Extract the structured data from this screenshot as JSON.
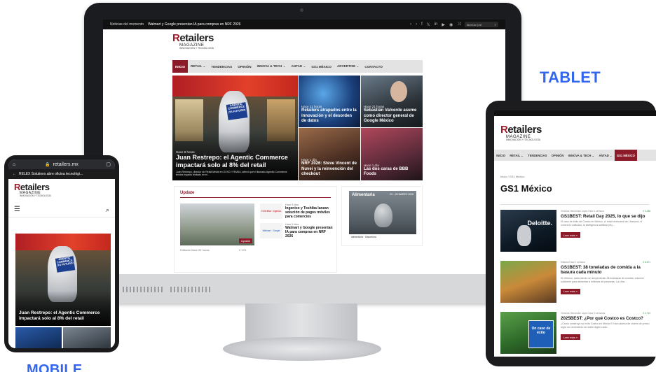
{
  "labels": {
    "tablet": "TABLET",
    "mobile": "MOBILE"
  },
  "desktop": {
    "topbar": {
      "label": "Noticias del momento",
      "ticker": "Walmart y Google presentan IA para compras en NRF 2026",
      "search": "Buscar por",
      "icons": [
        "facebook-icon",
        "x-icon",
        "linkedin-icon",
        "youtube-icon",
        "rss-icon",
        "shuffle-icon"
      ]
    },
    "logo": {
      "main_a": "R",
      "main_b": "etailers",
      "sub": "MAGAZINE",
      "tag": "INNOVACIÓN Y TECNOLOGÍA"
    },
    "nav": [
      "INICIO",
      "RETAIL ⌄",
      "TENDENCIAS",
      "OPINIÓN",
      "INNOVA & TECH ⌄",
      "ANTAD ⌄",
      "GS1 MÉXICO",
      "ADVERTISE ⌄",
      "CONTACTO"
    ],
    "hero_main": {
      "meta": "Hace 8 horas",
      "title": "Juan Restrepo: el Agentic Commerce impactará solo al 8% del retail",
      "excerpt": "Juan Restrepo, director de Retail Media en OXXO / FEMSA, afirmó que el llamado Agentic Commerce tendrá impacto limitado en el...",
      "sign": "AGENTIC COMMERCE ¡YA FUTURO!"
    },
    "tiles": [
      {
        "meta": "Hace 21 horas",
        "title": "Retailers atrapados entre la innovación y el desorden de datos"
      },
      {
        "meta": "Hace 21 horas",
        "title": "Sebastián Valverde asume como director general de Google México"
      },
      {
        "meta": "Hace 1 día",
        "title": "NRF 2026: Steve Vincent de Nuvei y la reinvención del checkout"
      },
      {
        "meta": "Hace 1 día",
        "title": "Las dos caras de BBB Foods"
      }
    ],
    "update": {
      "heading": "Update",
      "main_meta": "Editorial   Hace 22 horas",
      "badge": "Update",
      "stats": "0   176",
      "items": [
        {
          "meta": "Hace 5 días",
          "title": "Ingenico y Toshiba lanzan solución de pagos móviles para comercios",
          "logo": "TOSHIBA · ingenico"
        },
        {
          "meta": "Hace 5 días",
          "title": "Walmart y Google presentan IA para compras en NRF 2026",
          "logo": "Walmart · Google"
        }
      ]
    },
    "ad": {
      "title": "Alimentaria",
      "sub": "23 – 26 MARZO 2026",
      "footer": "alimentaria · Barcelona"
    }
  },
  "phone": {
    "url": "retailers.mx",
    "ticker": "RELEX Solutions abre oficina tecnológi...",
    "logo": {
      "main_a": "R",
      "main_b": "etailers",
      "sub": "MAGAZINE",
      "tag": "INNOVACIÓN Y TECNOLOGÍA"
    },
    "hero_title": "Juan Restrepo: el Agentic Commerce impactará solo al 8% del retail",
    "sign": "AGENTIC COMMERCE ¡YA FUTURO!"
  },
  "tablet": {
    "logo": {
      "main_a": "R",
      "main_b": "etailers",
      "sub": "MAGAZINE",
      "tag": "INNOVACIÓN Y TECNOLOGÍA"
    },
    "nav": [
      "INICIO",
      "RETAIL ⌄",
      "TENDENCIAS",
      "OPINIÓN",
      "INNOVA & TECH ⌄",
      "ANTAD ⌄",
      "GS1 MÉXICO"
    ],
    "breadcrumb": "Inicio / GS1 México",
    "page_title": "GS1 México",
    "read_more": "Leer más »",
    "articles": [
      {
        "meta": "Verónica Hernández López   Hace 1 semana",
        "stats": "0   3,338",
        "title": "GS1BEST: Retail Day 2025, lo que se dijo",
        "excerpt": "El caso de éxito de Costco en México, el retail omnicanal de Liverpool, el comercio unificado, la inteligencia artificial (IA)...",
        "img_text": "Deloitte."
      },
      {
        "meta": "Editorial   Hace 1 semana",
        "stats": "0   6,871",
        "title": "GS1BEST: 38 toneladas de comida a la basura cada minuto",
        "excerpt": "En México, cada minuto se desperdician 38 toneladas de comida, volumen suficiente para alimentar a millones de personas. La cifra...",
        "img_text": ""
      },
      {
        "meta": "Verónica Hernández López   Hace 3 semanas",
        "stats": "0   2,713",
        "title": "2025BEST: ¿Por qué Costco es Costco?",
        "excerpt": "¿Cómo construyó su éxito Costco en México? Esta cadena de clubes de precio logró un crecimiento de doble dígito cada...",
        "img_text": "Un caso de éxito"
      }
    ]
  }
}
